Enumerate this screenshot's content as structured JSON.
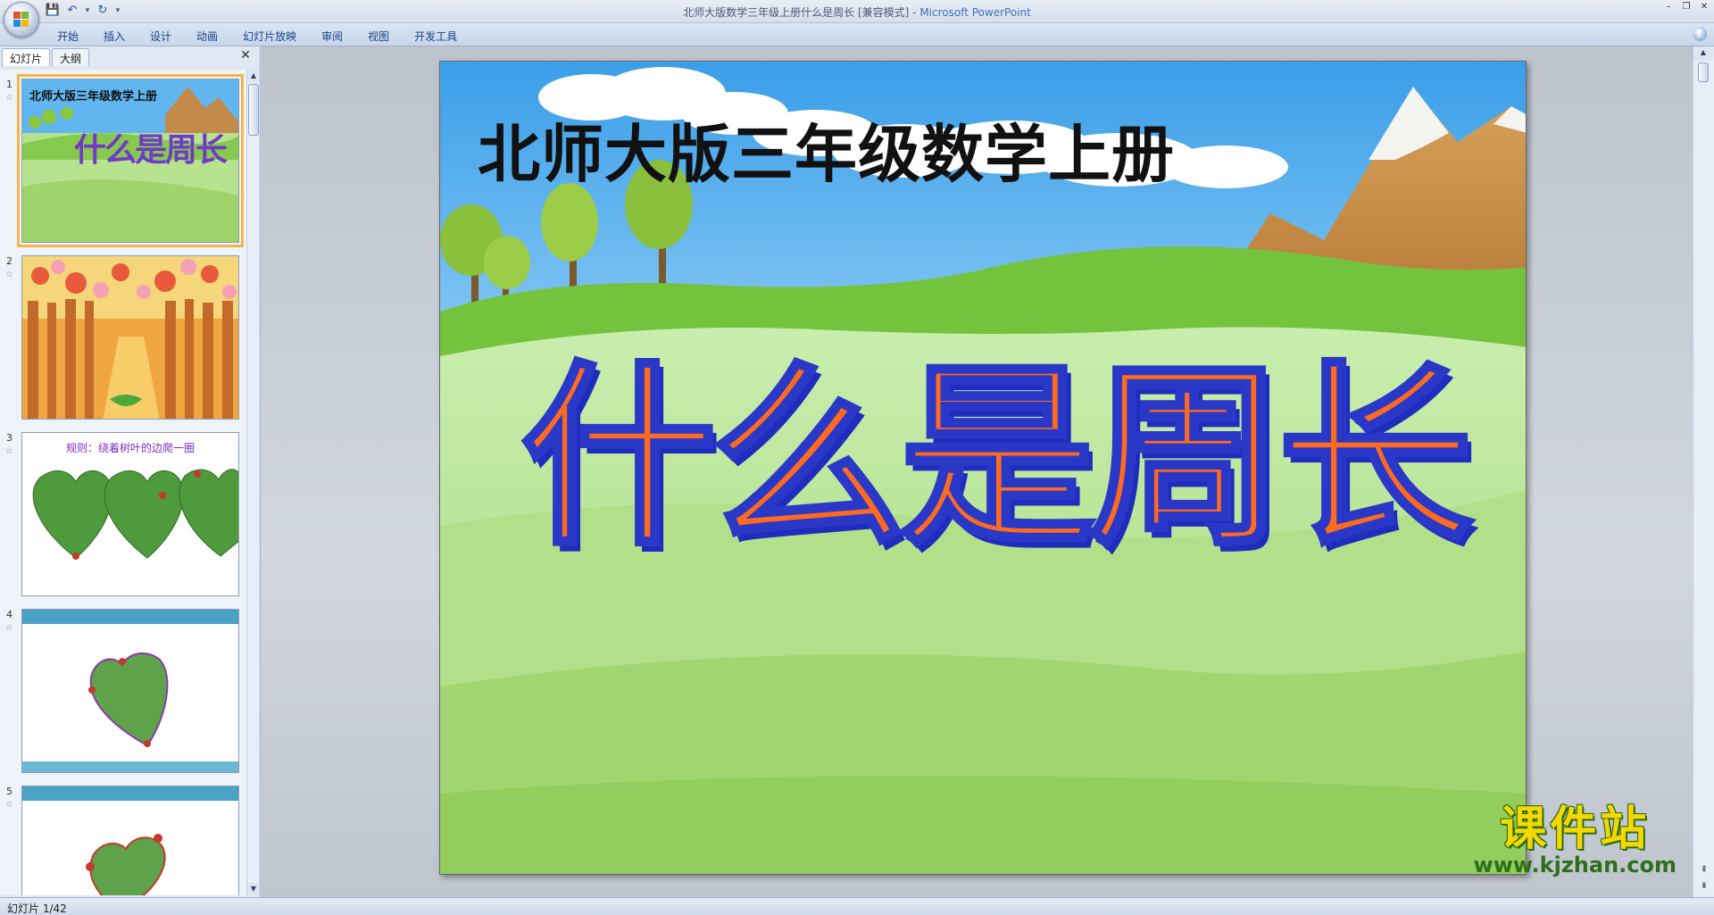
{
  "window": {
    "title": "北师大版数学三年级上册什么是周长 [兼容模式]",
    "title_separator": " - ",
    "app_name": "Microsoft PowerPoint"
  },
  "quick_access": [
    {
      "icon": "save-icon",
      "glyph": "💾"
    },
    {
      "icon": "undo-icon",
      "glyph": "↶"
    },
    {
      "icon": "redo-icon",
      "glyph": "↻"
    }
  ],
  "ribbon": {
    "tabs": [
      "开始",
      "插入",
      "设计",
      "动画",
      "幻灯片放映",
      "审阅",
      "视图",
      "开发工具"
    ]
  },
  "left_panel": {
    "tab_slides": "幻灯片",
    "tab_outline": "大纲",
    "thumbnails": [
      {
        "number": "1",
        "title": "北师大版三年级数学上册",
        "subtitle": "什么是周长"
      },
      {
        "number": "2"
      },
      {
        "number": "3",
        "caption": "规则：绕着树叶的边爬一圈"
      },
      {
        "number": "4"
      },
      {
        "number": "5"
      }
    ]
  },
  "slide": {
    "title": "北师大版三年级数学上册",
    "headline": "什么是周长"
  },
  "watermark": {
    "brand": "课件站",
    "url": "www.kjzhan.com"
  },
  "status": {
    "slide_info": "幻灯片 1/42"
  },
  "colors": {
    "accent": "#f7b448",
    "headline_fill": "#ff6a1f",
    "headline_stroke": "#2a38c8",
    "sky": "#5bb0ee",
    "grass": "#a9dc7c"
  }
}
